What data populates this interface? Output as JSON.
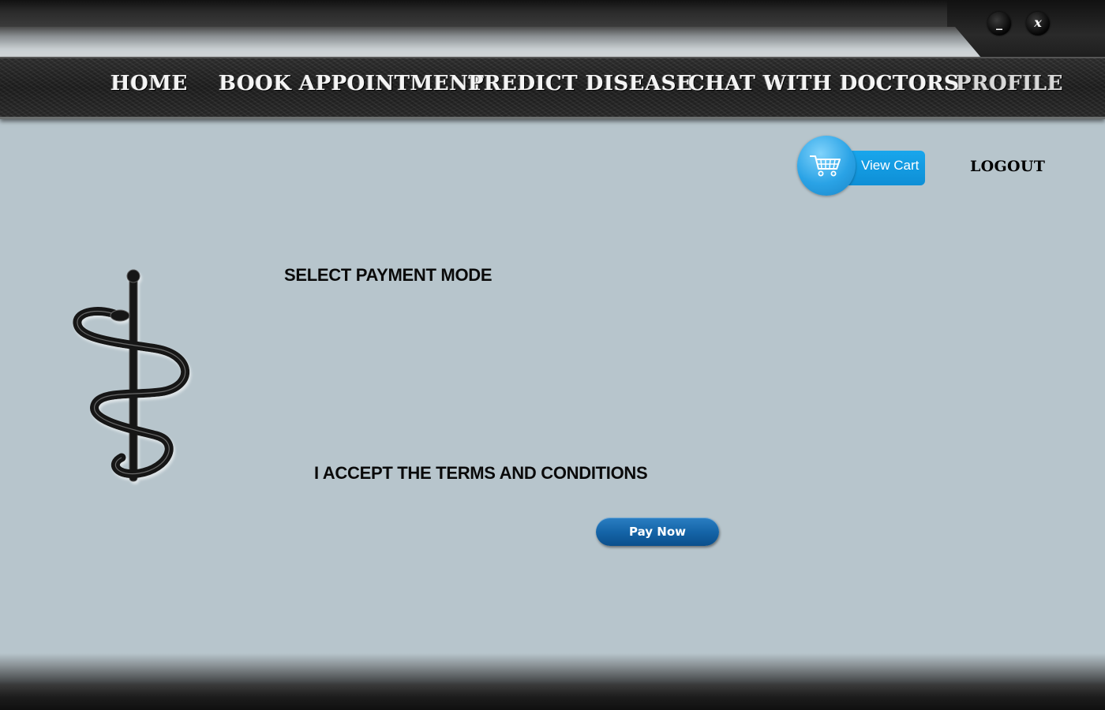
{
  "window_controls": {
    "minimize_label": "_",
    "close_label": "x"
  },
  "nav": {
    "items": [
      {
        "label": "HOME"
      },
      {
        "label": "BOOK APPOINTMENT"
      },
      {
        "label": "PREDICT DISEASE"
      },
      {
        "label": "CHAT WITH DOCTORS"
      },
      {
        "label": "PROFILE"
      }
    ]
  },
  "header": {
    "cart_label": "View Cart",
    "cart_icon": "shopping-cart-icon",
    "logout_label": "LOGOUT"
  },
  "main": {
    "logo_icon": "caduceus-icon",
    "payment_title": "SELECT PAYMENT MODE",
    "terms_label": "I ACCEPT THE TERMS AND CONDITIONS",
    "pay_button_label": "Pay Now"
  },
  "colors": {
    "background": "#b7c5cc",
    "nav_bar": "#2a2a2a",
    "cart_blue": "#1a9fe6",
    "pay_blue": "#1565a8"
  }
}
